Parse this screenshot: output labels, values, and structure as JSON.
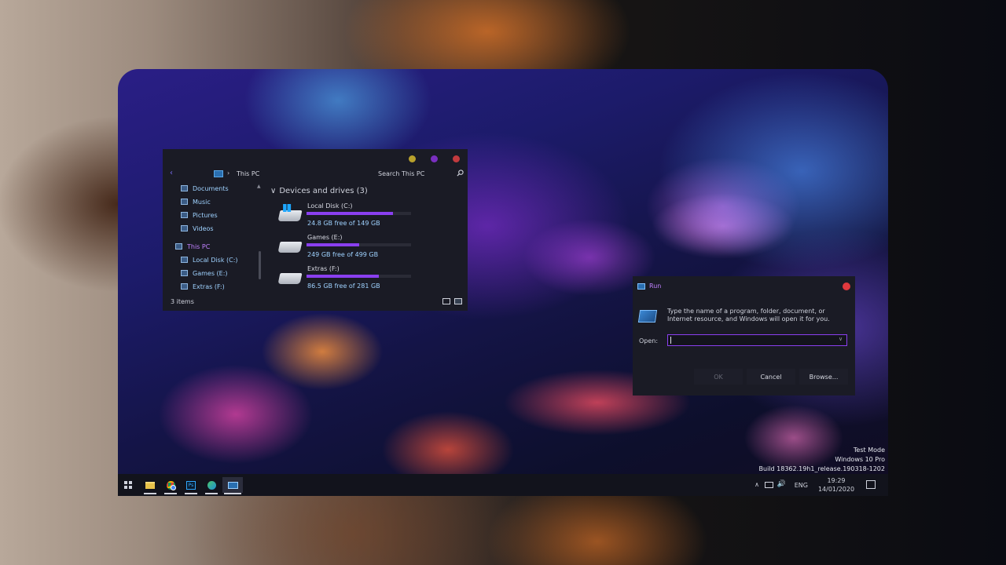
{
  "colors": {
    "accent": "#8a3ff0",
    "link": "#9fd2ff",
    "selected": "#c081ff",
    "close": "#e0393e",
    "minimize": "#b8a12c",
    "maximize": "#7a2fc0"
  },
  "explorer": {
    "breadcrumb": "This PC",
    "search_placeholder": "Search This PC",
    "sidebar": [
      {
        "label": "Documents",
        "icon": "documents-icon"
      },
      {
        "label": "Music",
        "icon": "music-icon"
      },
      {
        "label": "Pictures",
        "icon": "pictures-icon"
      },
      {
        "label": "Videos",
        "icon": "videos-icon"
      },
      {
        "label": "This PC",
        "icon": "this-pc-icon",
        "selected": true
      },
      {
        "label": "Local Disk (C:)",
        "icon": "drive-icon"
      },
      {
        "label": "Games (E:)",
        "icon": "drive-icon"
      },
      {
        "label": "Extras (F:)",
        "icon": "drive-icon"
      }
    ],
    "group_title": "Devices and drives (3)",
    "drives": [
      {
        "name": "Local Disk (C:)",
        "free": "24.8 GB free of 149 GB",
        "used_fraction": 0.83
      },
      {
        "name": "Games (E:)",
        "free": "249 GB free of 499 GB",
        "used_fraction": 0.5
      },
      {
        "name": "Extras (F:)",
        "free": "86.5 GB free of 281 GB",
        "used_fraction": 0.69
      }
    ],
    "status": "3 items"
  },
  "run": {
    "title": "Run",
    "description": "Type the name of a program, folder, document, or Internet resource, and Windows will open it for you.",
    "open_label": "Open:",
    "open_value": "",
    "ok": "OK",
    "cancel": "Cancel",
    "browse": "Browse..."
  },
  "watermark": {
    "line1": "Test Mode",
    "line2": "Windows 10 Pro",
    "line3": "Build 18362.19h1_release.190318-1202"
  },
  "taskbar": {
    "apps": [
      "file-explorer-icon",
      "chrome-icon",
      "photoshop-icon",
      "edge-icon",
      "run-icon"
    ],
    "ps_label": "Ps",
    "language": "ENG",
    "time": "19:29",
    "date": "14/01/2020"
  }
}
